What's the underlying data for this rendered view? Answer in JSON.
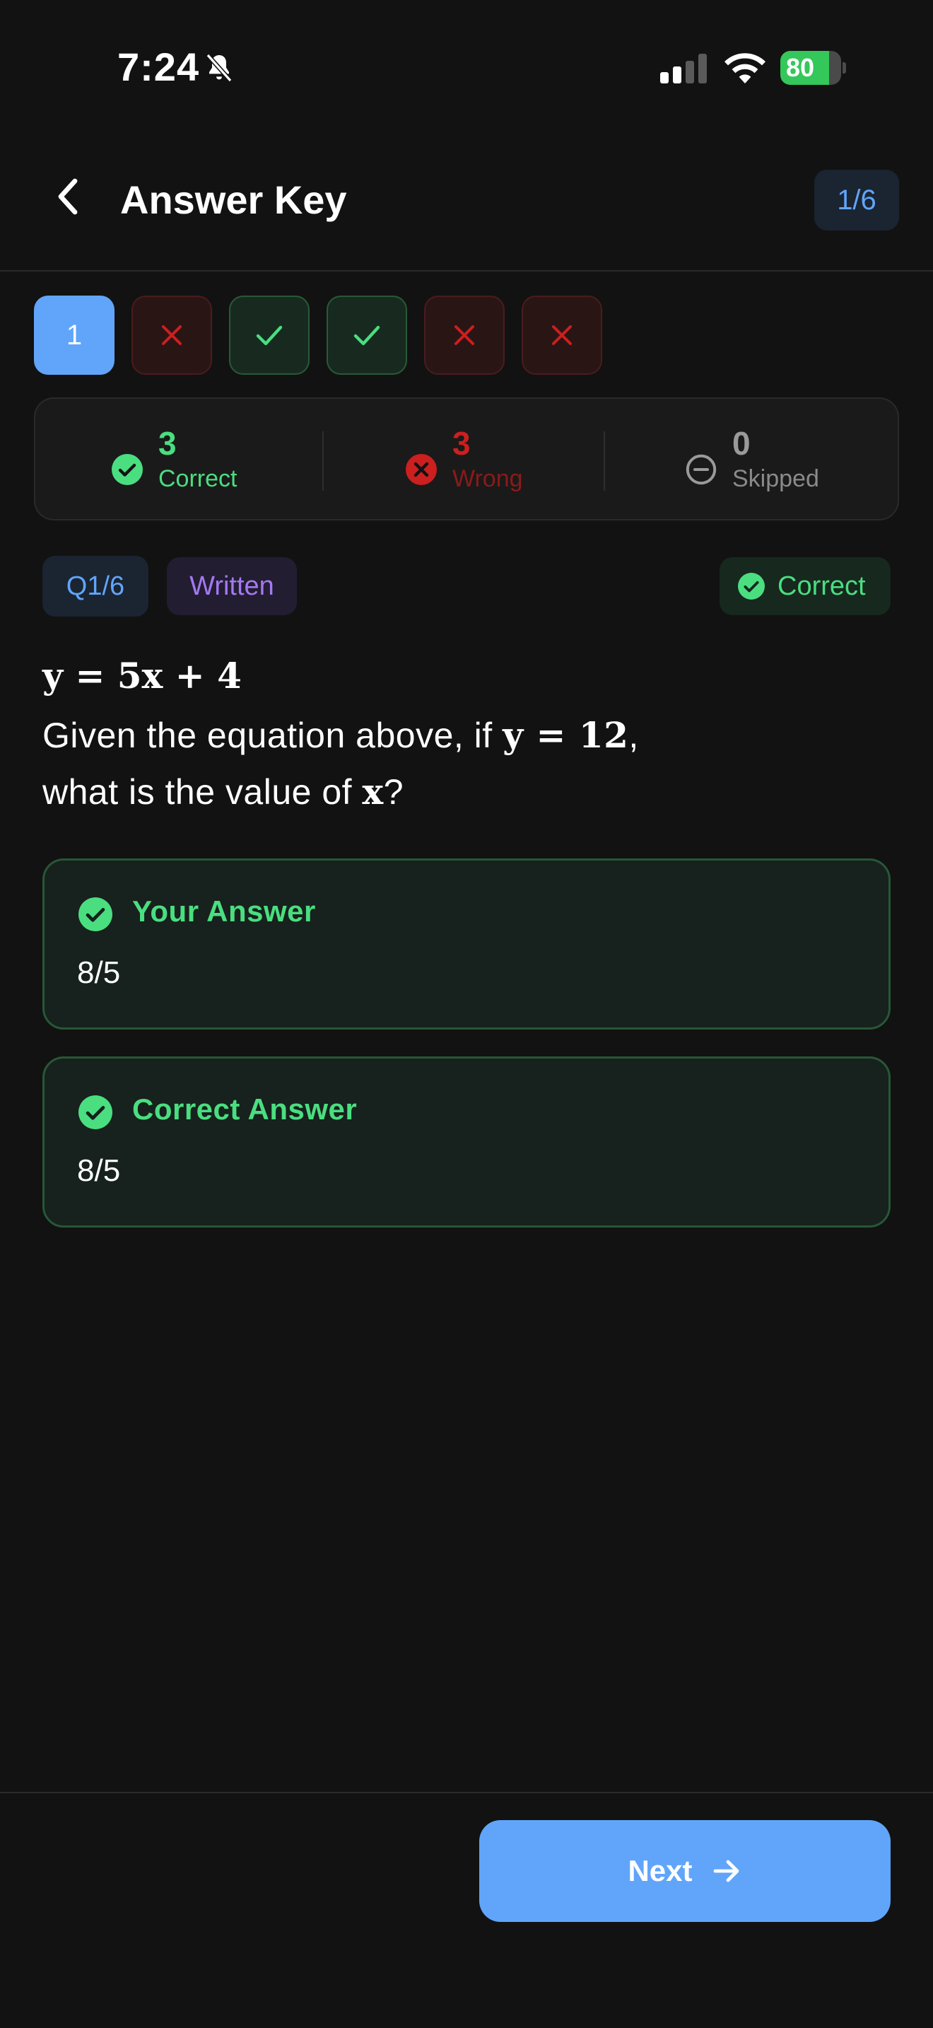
{
  "status_bar": {
    "time": "7:24",
    "battery_level": "80",
    "battery_fraction": 0.8,
    "icons": [
      "bell-slash-icon",
      "cellular-signal-icon",
      "wifi-icon",
      "battery-charging-icon"
    ]
  },
  "header": {
    "title": "Answer Key",
    "counter": "1/6"
  },
  "question_nav": [
    {
      "label": "1",
      "state": "current"
    },
    {
      "label": "",
      "state": "wrong"
    },
    {
      "label": "",
      "state": "correct"
    },
    {
      "label": "",
      "state": "correct"
    },
    {
      "label": "",
      "state": "wrong"
    },
    {
      "label": "",
      "state": "wrong"
    }
  ],
  "summary": {
    "correct": {
      "count": "3",
      "label": "Correct"
    },
    "wrong": {
      "count": "3",
      "label": "Wrong"
    },
    "skipped": {
      "count": "0",
      "label": "Skipped"
    }
  },
  "question": {
    "number_tag": "Q1/6",
    "type_tag": "Written",
    "result_tag": "Correct",
    "equation": "y = 5x + 4",
    "text_part1": "Given the equation above, if ",
    "math1": "y = 12",
    "text_part2": ",",
    "text_part3": "what is the value of ",
    "math2": "x",
    "text_part4": "?"
  },
  "answers": {
    "your_answer_title": "Your Answer",
    "your_answer_value": "8/5",
    "correct_answer_title": "Correct Answer",
    "correct_answer_value": "8/5"
  },
  "footer": {
    "next_label": "Next"
  },
  "colors": {
    "background": "#121212",
    "accent_blue": "#60a5fa",
    "correct_green": "#4ade80",
    "wrong_red": "#cc1f1f",
    "skipped_gray": "#9a9a9a",
    "written_purple": "#a478f2"
  }
}
